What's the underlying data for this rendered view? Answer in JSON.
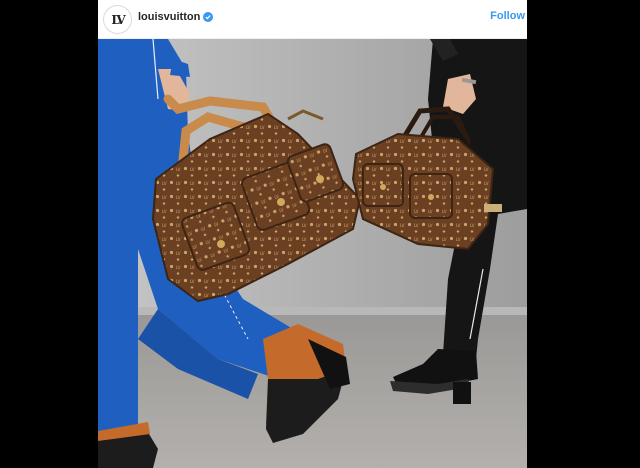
{
  "post": {
    "username": "louisvuitton",
    "follow_label": "Follow",
    "avatar_icon": "lv-monogram-logo-icon",
    "verified_icon": "verified-badge-icon"
  },
  "photo": {
    "subject_icon": "monogram-handbags-photo"
  },
  "colors": {
    "link_blue": "#3897f0",
    "verified_blue": "#3897f0",
    "monogram_brown": "#6b3f22",
    "trousers_blue": "#1f5fbf"
  }
}
